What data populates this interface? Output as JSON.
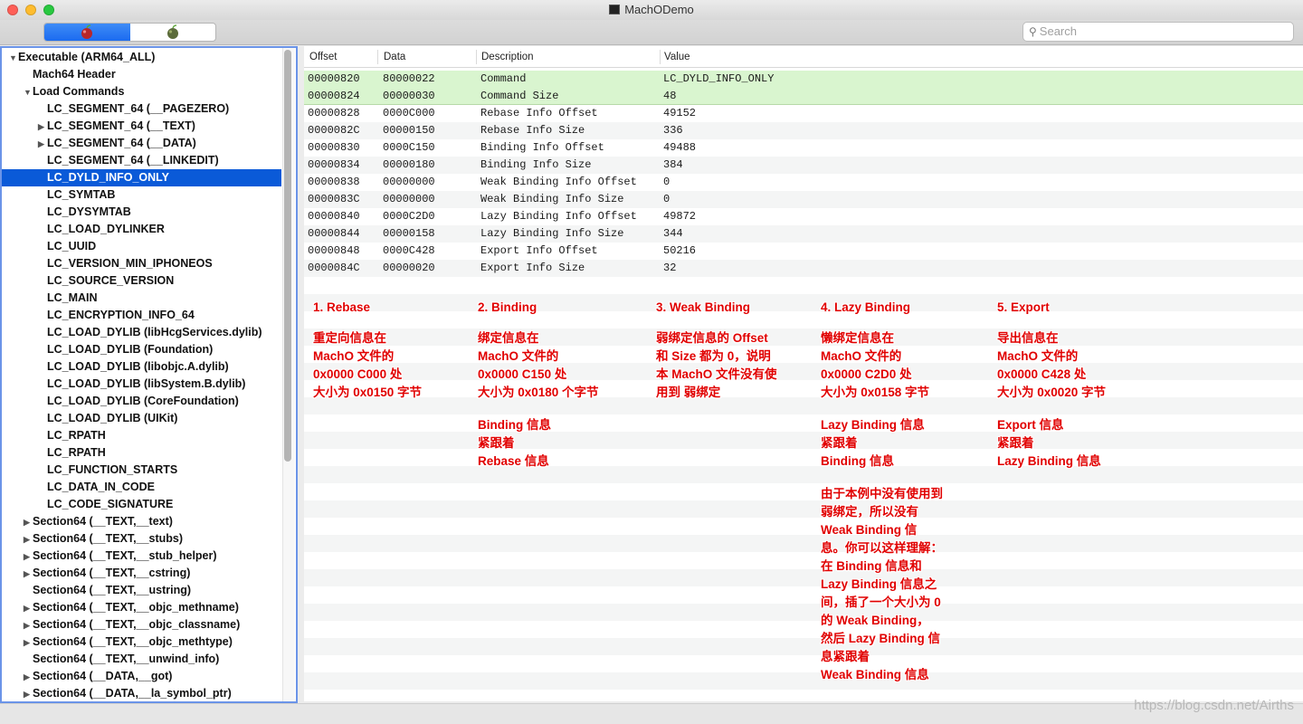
{
  "window": {
    "title": "MachODemo",
    "traffic_colors": [
      "#fe5f57",
      "#febc2e",
      "#28c840"
    ]
  },
  "toolbar": {
    "segments": [
      {
        "icon": "apple-bomb-icon",
        "active": true
      },
      {
        "icon": "apple-bomb-icon",
        "active": false
      }
    ],
    "search_placeholder": "Search"
  },
  "tree": [
    {
      "label": "Executable  (ARM64_ALL)",
      "indent": 0,
      "arrow": "▼",
      "selected": false
    },
    {
      "label": "Mach64 Header",
      "indent": 1,
      "arrow": "",
      "selected": false
    },
    {
      "label": "Load Commands",
      "indent": 1,
      "arrow": "▼",
      "selected": false
    },
    {
      "label": "LC_SEGMENT_64 (__PAGEZERO)",
      "indent": 2,
      "arrow": "",
      "selected": false
    },
    {
      "label": "LC_SEGMENT_64 (__TEXT)",
      "indent": 2,
      "arrow": "▶",
      "selected": false
    },
    {
      "label": "LC_SEGMENT_64 (__DATA)",
      "indent": 2,
      "arrow": "▶",
      "selected": false
    },
    {
      "label": "LC_SEGMENT_64 (__LINKEDIT)",
      "indent": 2,
      "arrow": "",
      "selected": false
    },
    {
      "label": "LC_DYLD_INFO_ONLY",
      "indent": 2,
      "arrow": "",
      "selected": true
    },
    {
      "label": "LC_SYMTAB",
      "indent": 2,
      "arrow": "",
      "selected": false
    },
    {
      "label": "LC_DYSYMTAB",
      "indent": 2,
      "arrow": "",
      "selected": false
    },
    {
      "label": "LC_LOAD_DYLINKER",
      "indent": 2,
      "arrow": "",
      "selected": false
    },
    {
      "label": "LC_UUID",
      "indent": 2,
      "arrow": "",
      "selected": false
    },
    {
      "label": "LC_VERSION_MIN_IPHONEOS",
      "indent": 2,
      "arrow": "",
      "selected": false
    },
    {
      "label": "LC_SOURCE_VERSION",
      "indent": 2,
      "arrow": "",
      "selected": false
    },
    {
      "label": "LC_MAIN",
      "indent": 2,
      "arrow": "",
      "selected": false
    },
    {
      "label": "LC_ENCRYPTION_INFO_64",
      "indent": 2,
      "arrow": "",
      "selected": false
    },
    {
      "label": "LC_LOAD_DYLIB (libHcgServices.dylib)",
      "indent": 2,
      "arrow": "",
      "selected": false
    },
    {
      "label": "LC_LOAD_DYLIB (Foundation)",
      "indent": 2,
      "arrow": "",
      "selected": false
    },
    {
      "label": "LC_LOAD_DYLIB (libobjc.A.dylib)",
      "indent": 2,
      "arrow": "",
      "selected": false
    },
    {
      "label": "LC_LOAD_DYLIB (libSystem.B.dylib)",
      "indent": 2,
      "arrow": "",
      "selected": false
    },
    {
      "label": "LC_LOAD_DYLIB (CoreFoundation)",
      "indent": 2,
      "arrow": "",
      "selected": false
    },
    {
      "label": "LC_LOAD_DYLIB (UIKit)",
      "indent": 2,
      "arrow": "",
      "selected": false
    },
    {
      "label": "LC_RPATH",
      "indent": 2,
      "arrow": "",
      "selected": false
    },
    {
      "label": "LC_RPATH",
      "indent": 2,
      "arrow": "",
      "selected": false
    },
    {
      "label": "LC_FUNCTION_STARTS",
      "indent": 2,
      "arrow": "",
      "selected": false
    },
    {
      "label": "LC_DATA_IN_CODE",
      "indent": 2,
      "arrow": "",
      "selected": false
    },
    {
      "label": "LC_CODE_SIGNATURE",
      "indent": 2,
      "arrow": "",
      "selected": false
    },
    {
      "label": "Section64 (__TEXT,__text)",
      "indent": 1,
      "arrow": "▶",
      "selected": false
    },
    {
      "label": "Section64 (__TEXT,__stubs)",
      "indent": 1,
      "arrow": "▶",
      "selected": false
    },
    {
      "label": "Section64 (__TEXT,__stub_helper)",
      "indent": 1,
      "arrow": "▶",
      "selected": false
    },
    {
      "label": "Section64 (__TEXT,__cstring)",
      "indent": 1,
      "arrow": "▶",
      "selected": false
    },
    {
      "label": "Section64 (__TEXT,__ustring)",
      "indent": 1,
      "arrow": "",
      "selected": false
    },
    {
      "label": "Section64 (__TEXT,__objc_methname)",
      "indent": 1,
      "arrow": "▶",
      "selected": false
    },
    {
      "label": "Section64 (__TEXT,__objc_classname)",
      "indent": 1,
      "arrow": "▶",
      "selected": false
    },
    {
      "label": "Section64 (__TEXT,__objc_methtype)",
      "indent": 1,
      "arrow": "▶",
      "selected": false
    },
    {
      "label": "Section64 (__TEXT,__unwind_info)",
      "indent": 1,
      "arrow": "",
      "selected": false
    },
    {
      "label": "Section64 (__DATA,__got)",
      "indent": 1,
      "arrow": "▶",
      "selected": false
    },
    {
      "label": "Section64 (__DATA,__la_symbol_ptr)",
      "indent": 1,
      "arrow": "▶",
      "selected": false
    }
  ],
  "table": {
    "columns": [
      "Offset",
      "Data",
      "Description",
      "Value"
    ],
    "rows": [
      {
        "offset": "00000820",
        "data": "80000022",
        "description": "Command",
        "value": "LC_DYLD_INFO_ONLY",
        "highlight": true
      },
      {
        "offset": "00000824",
        "data": "00000030",
        "description": "Command Size",
        "value": "48",
        "highlight": true
      },
      {
        "offset": "00000828",
        "data": "0000C000",
        "description": "Rebase Info Offset",
        "value": "49152",
        "highlight": false
      },
      {
        "offset": "0000082C",
        "data": "00000150",
        "description": "Rebase Info Size",
        "value": "336",
        "highlight": false
      },
      {
        "offset": "00000830",
        "data": "0000C150",
        "description": "Binding Info Offset",
        "value": "49488",
        "highlight": false
      },
      {
        "offset": "00000834",
        "data": "00000180",
        "description": "Binding Info Size",
        "value": "384",
        "highlight": false
      },
      {
        "offset": "00000838",
        "data": "00000000",
        "description": "Weak Binding Info Offset",
        "value": "0",
        "highlight": false
      },
      {
        "offset": "0000083C",
        "data": "00000000",
        "description": "Weak Binding Info Size",
        "value": "0",
        "highlight": false
      },
      {
        "offset": "00000840",
        "data": "0000C2D0",
        "description": "Lazy Binding Info Offset",
        "value": "49872",
        "highlight": false
      },
      {
        "offset": "00000844",
        "data": "00000158",
        "description": "Lazy Binding Info Size",
        "value": "344",
        "highlight": false
      },
      {
        "offset": "00000848",
        "data": "0000C428",
        "description": "Export Info Offset",
        "value": "50216",
        "highlight": false
      },
      {
        "offset": "0000084C",
        "data": "00000020",
        "description": "Export Info Size",
        "value": "32",
        "highlight": false
      }
    ]
  },
  "annotations": [
    {
      "lines": [
        "1. Rebase",
        "",
        "重定向信息在",
        "MachO 文件的",
        "0x0000 C000 处",
        "大小为 0x0150 字节"
      ]
    },
    {
      "lines": [
        "2. Binding",
        "",
        "绑定信息在",
        "MachO 文件的",
        "0x0000 C150 处",
        "大小为 0x0180 个字节",
        "",
        "Binding 信息",
        "紧跟着",
        "Rebase 信息"
      ]
    },
    {
      "lines": [
        "3. Weak Binding",
        "",
        "弱绑定信息的 Offset",
        "和 Size 都为 0，说明",
        "本 MachO 文件没有使",
        "用到 弱绑定"
      ]
    },
    {
      "lines": [
        "4. Lazy Binding",
        "",
        "懒绑定信息在",
        "MachO 文件的",
        "0x0000 C2D0 处",
        "大小为 0x0158 字节",
        "",
        "Lazy Binding 信息",
        "紧跟着",
        "Binding 信息",
        "",
        "由于本例中没有使用到",
        "弱绑定，所以没有",
        "Weak Binding 信",
        "息。你可以这样理解：",
        "在 Binding 信息和",
        "Lazy Binding 信息之",
        "间，插了一个大小为 0",
        "的 Weak Binding，",
        "然后 Lazy Binding 信",
        "息紧跟着",
        "Weak Binding 信息"
      ]
    },
    {
      "lines": [
        "5. Export",
        "",
        "导出信息在",
        "MachO 文件的",
        "0x0000 C428 处",
        "大小为 0x0020 字节",
        "",
        "Export 信息",
        "紧跟着",
        "Lazy Binding 信息"
      ]
    }
  ],
  "watermark": "https://blog.csdn.net/Airths"
}
